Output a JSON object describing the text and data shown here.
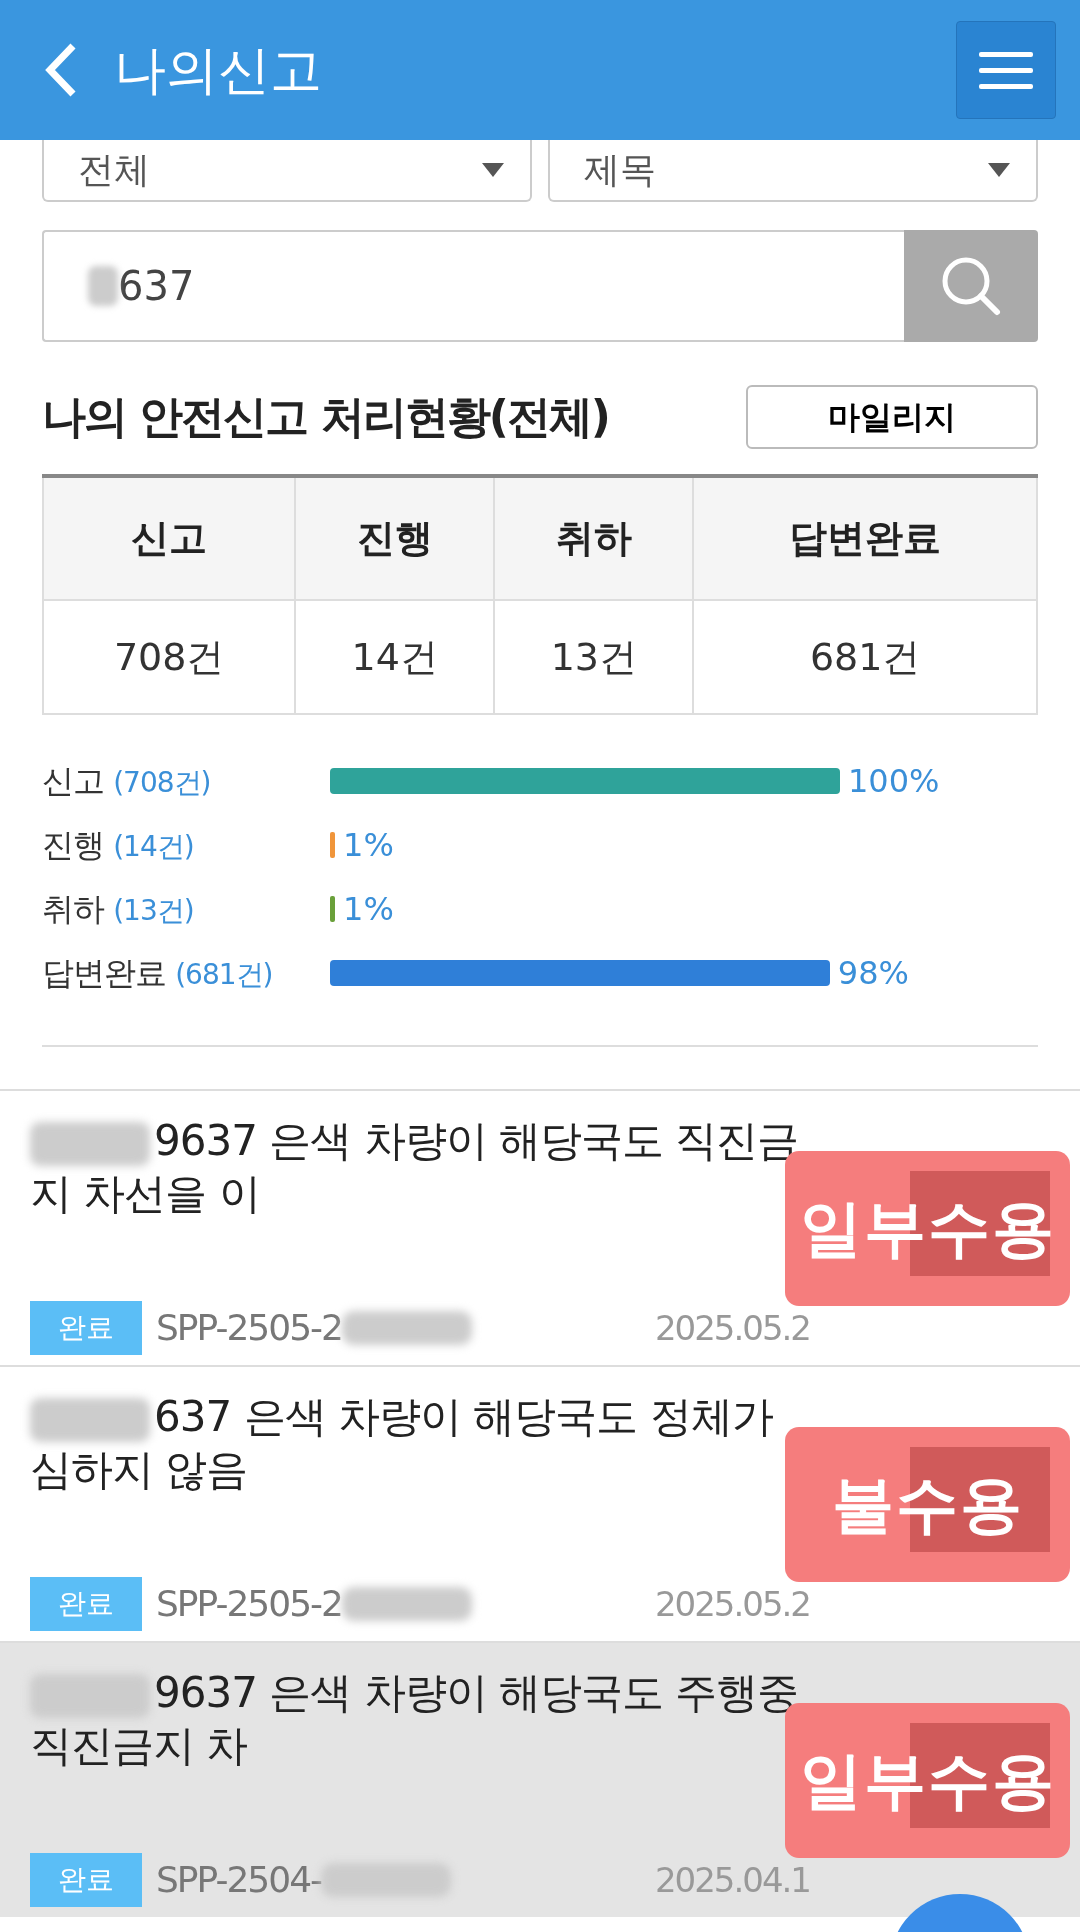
{
  "header": {
    "title": "나의신고"
  },
  "filters": [
    {
      "value": "전체"
    },
    {
      "value": "제목"
    }
  ],
  "search": {
    "value": "637"
  },
  "summary": {
    "title": "나의 안전신고 처리현황(전체)",
    "button": "마일리지"
  },
  "stats_table": {
    "columns": [
      "신고",
      "진행",
      "취하",
      "답변완료"
    ],
    "values": [
      "708건",
      "14건",
      "13건",
      "681건"
    ]
  },
  "bars": [
    {
      "label": "신고",
      "count": "(708건)",
      "level": 1.0,
      "reading": "100%",
      "color": "#2fa39a"
    },
    {
      "label": "진행",
      "count": "(14건)",
      "level": 0.01,
      "reading": "1%",
      "color": "#f0953a"
    },
    {
      "label": "취하",
      "count": "(13건)",
      "level": 0.01,
      "reading": "1%",
      "color": "#6aa03a"
    },
    {
      "label": "답변완료",
      "count": "(681건)",
      "level": 0.98,
      "reading": "98%",
      "color": "#2f7fd8"
    }
  ],
  "reports": [
    {
      "title": "9637 은색 차량이 해당국도 직진금지 차선을 이",
      "status": "완료",
      "ref": "SPP-2505-2",
      "date": "2025.05.2",
      "sticker": "일부수용",
      "selected": false
    },
    {
      "title": "637 은색 차량이 해당국도 정체가 심하지 않음",
      "status": "완료",
      "ref": "SPP-2505-2",
      "date": "2025.05.2",
      "sticker": "불수용",
      "selected": false
    },
    {
      "title": "9637 은색 차량이 해당국도 주행중 직진금지 차",
      "status": "완료",
      "ref": "SPP-2504-",
      "date": "2025.04.1",
      "sticker": "일부수용",
      "selected": true
    }
  ]
}
